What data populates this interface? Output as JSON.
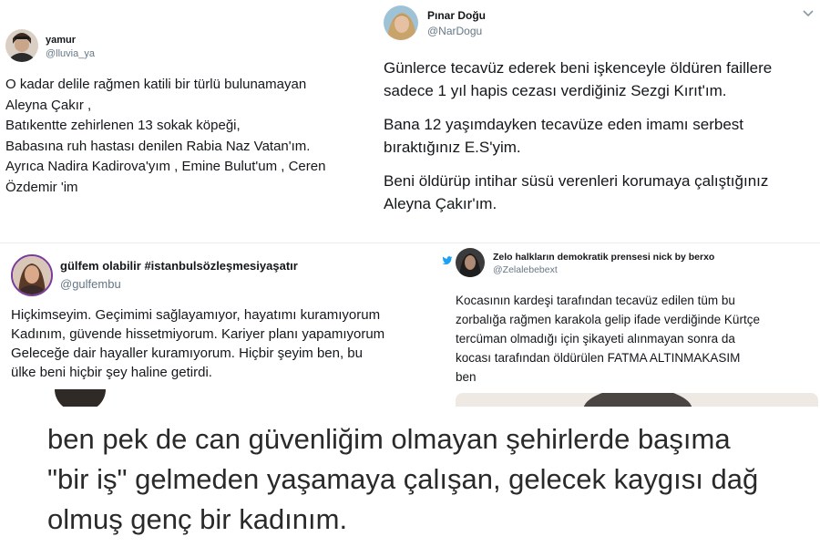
{
  "tweets": [
    {
      "name": "yamur",
      "handle": "@lluvia_ya",
      "lines": [
        "O kadar delile rağmen katili bir türlü bulunamayan",
        "Aleyna Çakır ,",
        "Batıkentte zehirlenen 13 sokak köpeği,",
        "Babasına ruh hastası denilen Rabia Naz Vatan'ım.",
        "Ayrıca Nadira Kadirova'yım , Emine Bulut'um , Ceren",
        "Özdemir 'im"
      ]
    },
    {
      "name": "Pınar Doğu",
      "handle": "@NarDogu",
      "paragraphs": [
        "Günlerce tecavüz ederek beni işkenceyle öldüren faillere sadece 1 yıl hapis cezası verdiğiniz Sezgi Kırıt'ım.",
        "Bana 12 yaşımdayken tecavüze eden imamı serbest bıraktığınız E.S'yim.",
        "Beni öldürüp intihar süsü verenleri korumaya çalıştığınız Aleyna Çakır'ım."
      ]
    },
    {
      "name": "gülfem olabilir #istanbulsözleşmesiyaşatır",
      "handle": "@gulfembu",
      "lines": [
        "Hiçkimseyim. Geçimimi sağlayamıyor, hayatımı kuramıyorum",
        "Kadınım, güvende hissetmiyorum. Kariyer planı yapamıyorum",
        "Geleceğe dair hayaller kuramıyorum. Hiçbir şeyim ben, bu",
        "ülke beni hiçbir şey haline getirdi."
      ]
    },
    {
      "name": "Zelo halkların demokratik prensesi nick by berxo",
      "handle": "@Zelalebebext",
      "lines": [
        "Kocasının kardeşi tarafından tecavüz edilen tüm bu",
        "zorbalığa rağmen karakola gelip ifade verdiğinde Kürtçe",
        "tercüman olmadığı için şikayeti alınmayan sonra da",
        "kocası tarafından öldürülen FATMA ALTINMAKASIM",
        "ben"
      ]
    }
  ],
  "caption": {
    "lines": [
      "ben pek de can güvenliğim olmayan şehirlerde başıma",
      "\"bir iş\" gelmeden yaşamaya çalışan, gelecek kaygısı dağ",
      "olmuş genç bir kadınım."
    ]
  },
  "icons": {
    "platform": "twitter-bird-icon",
    "menu": "chevron-down-icon"
  },
  "colors": {
    "text": "#14171a",
    "handle": "#657786",
    "twitter_blue": "#1da1f2",
    "caption_text": "#2a2a2a"
  }
}
